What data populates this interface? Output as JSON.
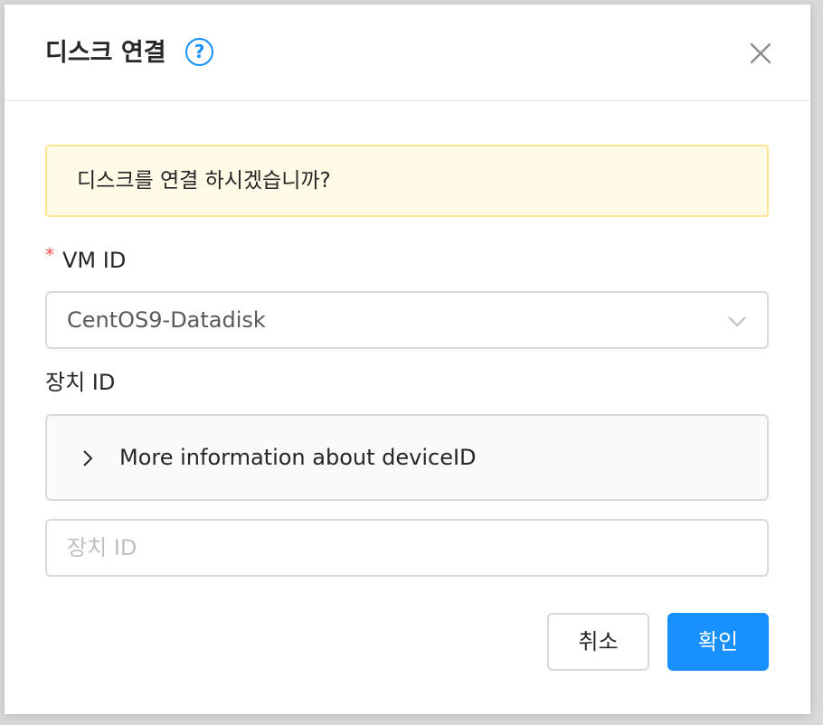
{
  "dialog": {
    "title": "디스크 연결",
    "help_icon": "question-circle-icon",
    "help_glyph": "?",
    "close_icon": "close-icon"
  },
  "alert": {
    "message": "디스크를 연결 하시겠습니까?",
    "color": "#fffbe6",
    "border_color": "#ffe58f"
  },
  "form": {
    "vm_id": {
      "required_mark": "*",
      "label": "VM ID",
      "value": "CentOS9-Datadisk"
    },
    "device_id": {
      "label": "장치 ID",
      "collapse_label": "More information about deviceID",
      "placeholder": "장치 ID",
      "value": ""
    }
  },
  "footer": {
    "cancel_label": "취소",
    "ok_label": "확인"
  },
  "colors": {
    "primary": "#1890ff",
    "required": "#ff4d4f"
  }
}
